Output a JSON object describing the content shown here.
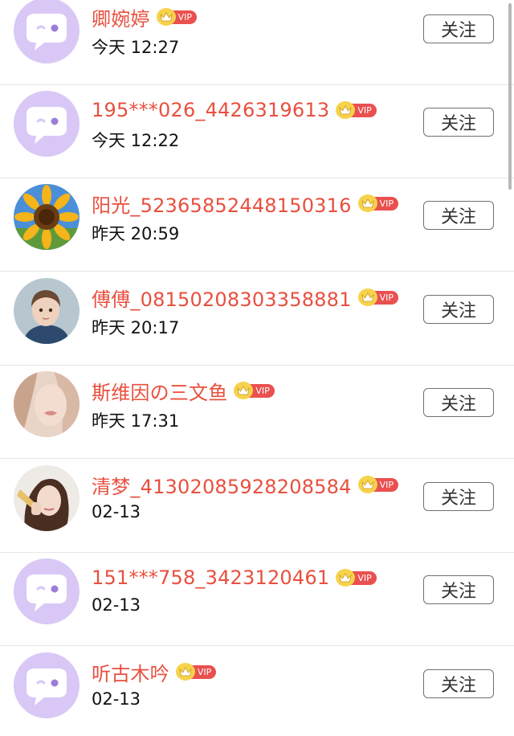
{
  "follow_label": "关注",
  "vip_label": "VIP",
  "colors": {
    "name": "#e8503f",
    "vip_badge": "#e9504f",
    "crown": "#f7d24b",
    "default_avatar_bg": "#d9c8f6"
  },
  "users": [
    {
      "name": "卿婉婷",
      "time": "今天 12:27",
      "avatar": "default-chat-avatar"
    },
    {
      "name": "195***026_4426319613",
      "time": "今天 12:22",
      "avatar": "default-chat-avatar"
    },
    {
      "name": "阳光_52365852448150316",
      "time": "昨天 20:59",
      "avatar": "sunflower-photo"
    },
    {
      "name": "傅傅_08150208303358881",
      "time": "昨天 20:17",
      "avatar": "child-photo"
    },
    {
      "name": "斯维因の三文鱼",
      "time": "昨天 17:31",
      "avatar": "face-photo"
    },
    {
      "name": "清梦_41302085928208584",
      "time": "02-13",
      "avatar": "woman-photo"
    },
    {
      "name": "151***758_3423120461",
      "time": "02-13",
      "avatar": "default-chat-avatar"
    },
    {
      "name": "听古木吟",
      "time": "02-13",
      "avatar": "default-chat-avatar"
    }
  ]
}
